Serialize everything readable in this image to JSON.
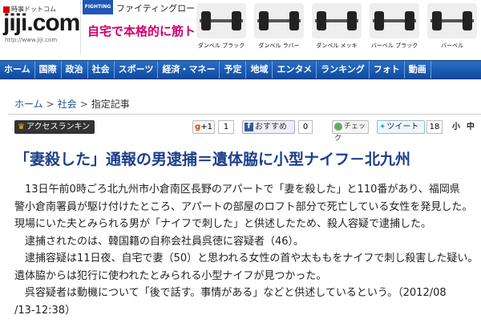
{
  "logo": {
    "small": "時事ドットコム",
    "main": "jiji.com",
    "url": "http://www.jiji.com"
  },
  "ad": {
    "sponsor": "FIGHTING ROAD",
    "brand": "ファイティングロード",
    "slogan": "自宅で本格的に筋トレ!",
    "products": [
      {
        "label": "ダンベル ブラック"
      },
      {
        "label": "ダンベル ラバー"
      },
      {
        "label": "ダンベル メッキ"
      },
      {
        "label": "バーベル ブラック"
      },
      {
        "label": "バーベル"
      }
    ]
  },
  "nav": [
    "ホーム",
    "国際",
    "政治",
    "社会",
    "スポーツ",
    "経済・マネー",
    "予定",
    "地域",
    "エンタメ",
    "ランキング",
    "フォト",
    "動画"
  ],
  "breadcrumb": {
    "home": "ホーム",
    "section": "社会",
    "current": "指定記事",
    "sep": ">"
  },
  "toolbar": {
    "ranking": "アクセスランキング",
    "gplus": "+1",
    "gplus_count": "1",
    "fb_label": "おすすめ",
    "fb_count": "0",
    "check_label": "チェック",
    "tweet_label": "ツイート",
    "tweet_count": "18",
    "size_small": "小",
    "size_medium": "中"
  },
  "article": {
    "headline": "「妻殺した」通報の男逮捕＝遺体脇に小型ナイフ－北九州",
    "lines": [
      "　13日午前0時ごろ北九州市小倉南区長野のアパートで「妻を殺した」と110番があり、福岡県",
      "警小倉南署員が駆け付けたところ、アパートの部屋のロフト部分で死亡している女性を発見した。",
      "現場にいた夫とみられる男が「ナイフで刺した」と供述したため、殺人容疑で逮捕した。",
      "　逮捕されたのは、韓国籍の自称会社員呉徳に容疑者（46）。",
      "　逮捕容疑は11日夜、自宅で妻（50）と思われる女性の首や太ももをナイフで刺し殺害した疑い。",
      "遺体脇からは犯行に使われたとみられる小型ナイフが見つかった。",
      "　呉容疑者は動機について「後で話す。事情がある」などと供述しているという。（2012/08",
      "/13-12:38）"
    ]
  }
}
